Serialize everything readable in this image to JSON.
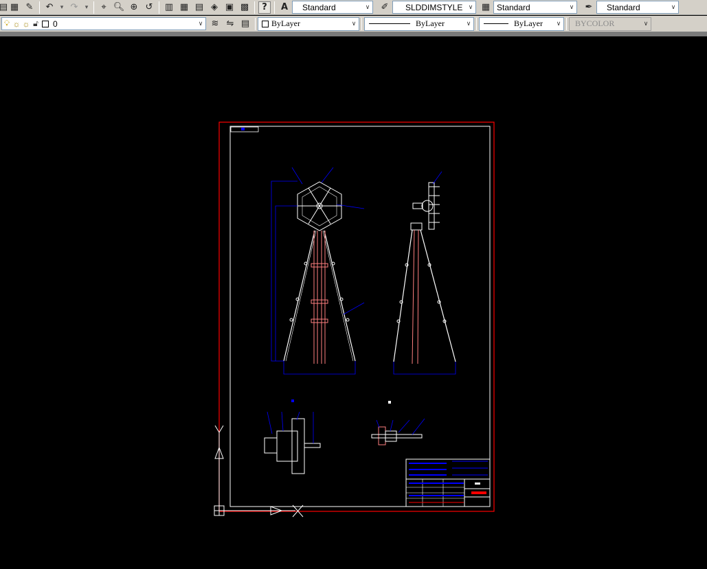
{
  "toolbar": {
    "text_style": "Standard",
    "dim_style": "SLDDIMSTYLE",
    "table_style": "Standard",
    "multileader_style": "Standard",
    "help_label": "?"
  },
  "layers": {
    "current_layer": "0",
    "color": "ByLayer",
    "linetype": "ByLayer",
    "lineweight": "ByLayer",
    "plot_style": "BYCOLOR"
  },
  "colors": {
    "background": "#000000",
    "frame_outer": "#ff0000",
    "frame_inner": "#ffffff",
    "dimension": "#0000ff",
    "center_part": "#ff8080",
    "ucs": "#ffffff"
  },
  "icons": [
    "new-file-icon",
    "save-icon",
    "publish-icon",
    "undo-icon",
    "redo-icon",
    "match-properties-icon",
    "zoom-realtime-icon",
    "zoom-window-icon",
    "zoom-previous-icon",
    "properties-icon",
    "design-center-icon",
    "tool-palette-icon",
    "sheet-set-icon",
    "markup-icon",
    "calculator-icon",
    "help-icon",
    "text-style-icon",
    "dim-style-icon",
    "table-style-icon",
    "multileader-style-icon",
    "bulb-icon",
    "sun-icon",
    "lock-icon",
    "layer-manager-icon",
    "layer-previous-icon"
  ]
}
